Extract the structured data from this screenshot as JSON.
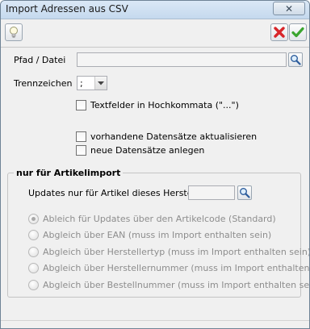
{
  "window": {
    "title": "Import Adressen aus CSV",
    "close_label": "✕"
  },
  "toolbar": {
    "hint_icon": "lightbulb-icon",
    "cancel_icon": "red-x-icon",
    "confirm_icon": "green-check-icon"
  },
  "form": {
    "path_label": "Pfad / Datei",
    "path_value": "",
    "separator_label": "Trennzeichen",
    "separator_value": ";",
    "quoted_fields_label": "Textfelder in Hochkommata (\"...\")",
    "quoted_fields_checked": false,
    "update_existing_label": "vorhandene Datensätze aktualisieren",
    "update_existing_checked": false,
    "create_new_label": "neue Datensätze anlegen",
    "create_new_checked": false
  },
  "article_import": {
    "group_title": "nur für Artikelimport",
    "manufacturer_label": "Updates nur für Artikel dieses Herstellers",
    "manufacturer_value": "",
    "options": [
      {
        "label": "Ableich für Updates über den Artikelcode (Standard)",
        "selected": true
      },
      {
        "label": "Abgleich über EAN (muss im Import enthalten sein)",
        "selected": false
      },
      {
        "label": "Abgleich über Herstellertyp (muss im Import enthalten sein)",
        "selected": false
      },
      {
        "label": "Abgleich über Herstellernummer (muss im Import enthalten sein)",
        "selected": false
      },
      {
        "label": "Abgleich über Bestellnummer (muss im Import enthalten sein)",
        "selected": false
      }
    ]
  },
  "colors": {
    "cancel_red": "#d8262a",
    "confirm_green": "#3ba52f",
    "titlebar": "#c5d9ee"
  }
}
